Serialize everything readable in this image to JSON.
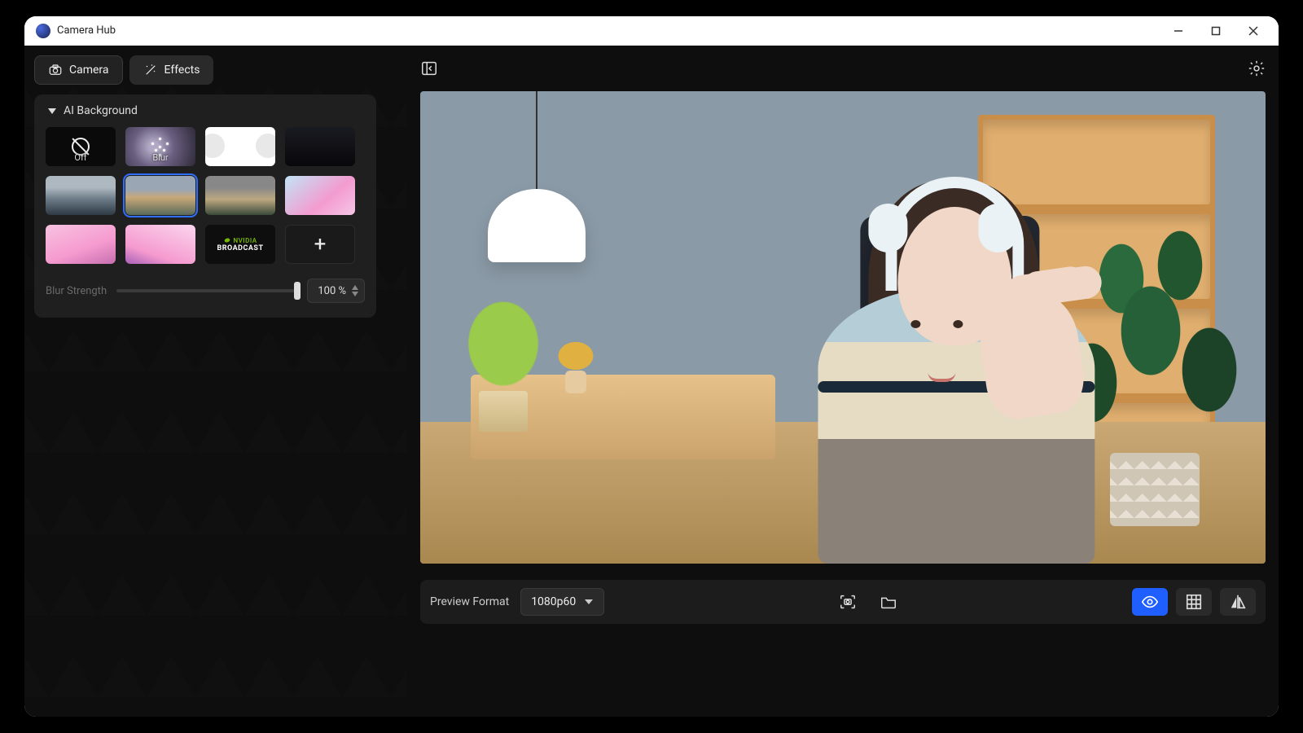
{
  "app": {
    "title": "Camera Hub"
  },
  "tabs": {
    "camera": "Camera",
    "effects": "Effects"
  },
  "panel": {
    "title": "AI Background",
    "thumbs": {
      "off": "Off",
      "blur": "Blur",
      "broadcast_brand": "NVIDIA",
      "broadcast_label": "BROADCAST",
      "add": "+"
    },
    "blur_strength_label": "Blur Strength",
    "blur_strength_value": "100 %"
  },
  "bottom": {
    "preview_format_label": "Preview Format",
    "preview_format_value": "1080p60"
  },
  "icons": {
    "search": "search-icon",
    "gear": "gear-icon"
  }
}
